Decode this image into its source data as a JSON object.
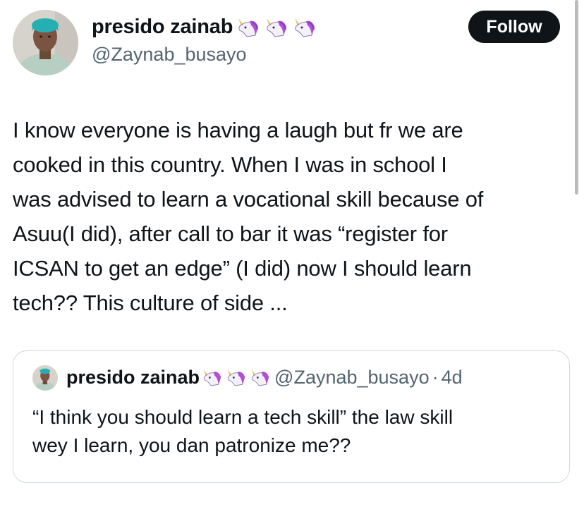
{
  "author": {
    "name": "presido zainab",
    "handle": "@Zaynab_busayo",
    "badges": [
      "unicorn-emoji",
      "unicorn-emoji",
      "unicorn-emoji"
    ]
  },
  "follow_label": "Follow",
  "tweet_text": "I know everyone is having a laugh but fr we are\ncooked in this country. When I was in school I\nwas advised to learn a vocational skill because of\nAsuu(I did), after call to bar it was “register for\nICSAN to get an edge” (I did) now I should learn\ntech?? This culture of side ...",
  "quote": {
    "name": "presido zainab",
    "handle": "@Zaynab_busayo",
    "separator": "·",
    "time": "4d",
    "text": "“I think you should learn a tech skill” the law skill\nwey I learn, you dan patronize me??"
  },
  "colors": {
    "text": "#0f1419",
    "secondary": "#536471",
    "follow_bg": "#0f1419",
    "border": "#cfd9de"
  }
}
